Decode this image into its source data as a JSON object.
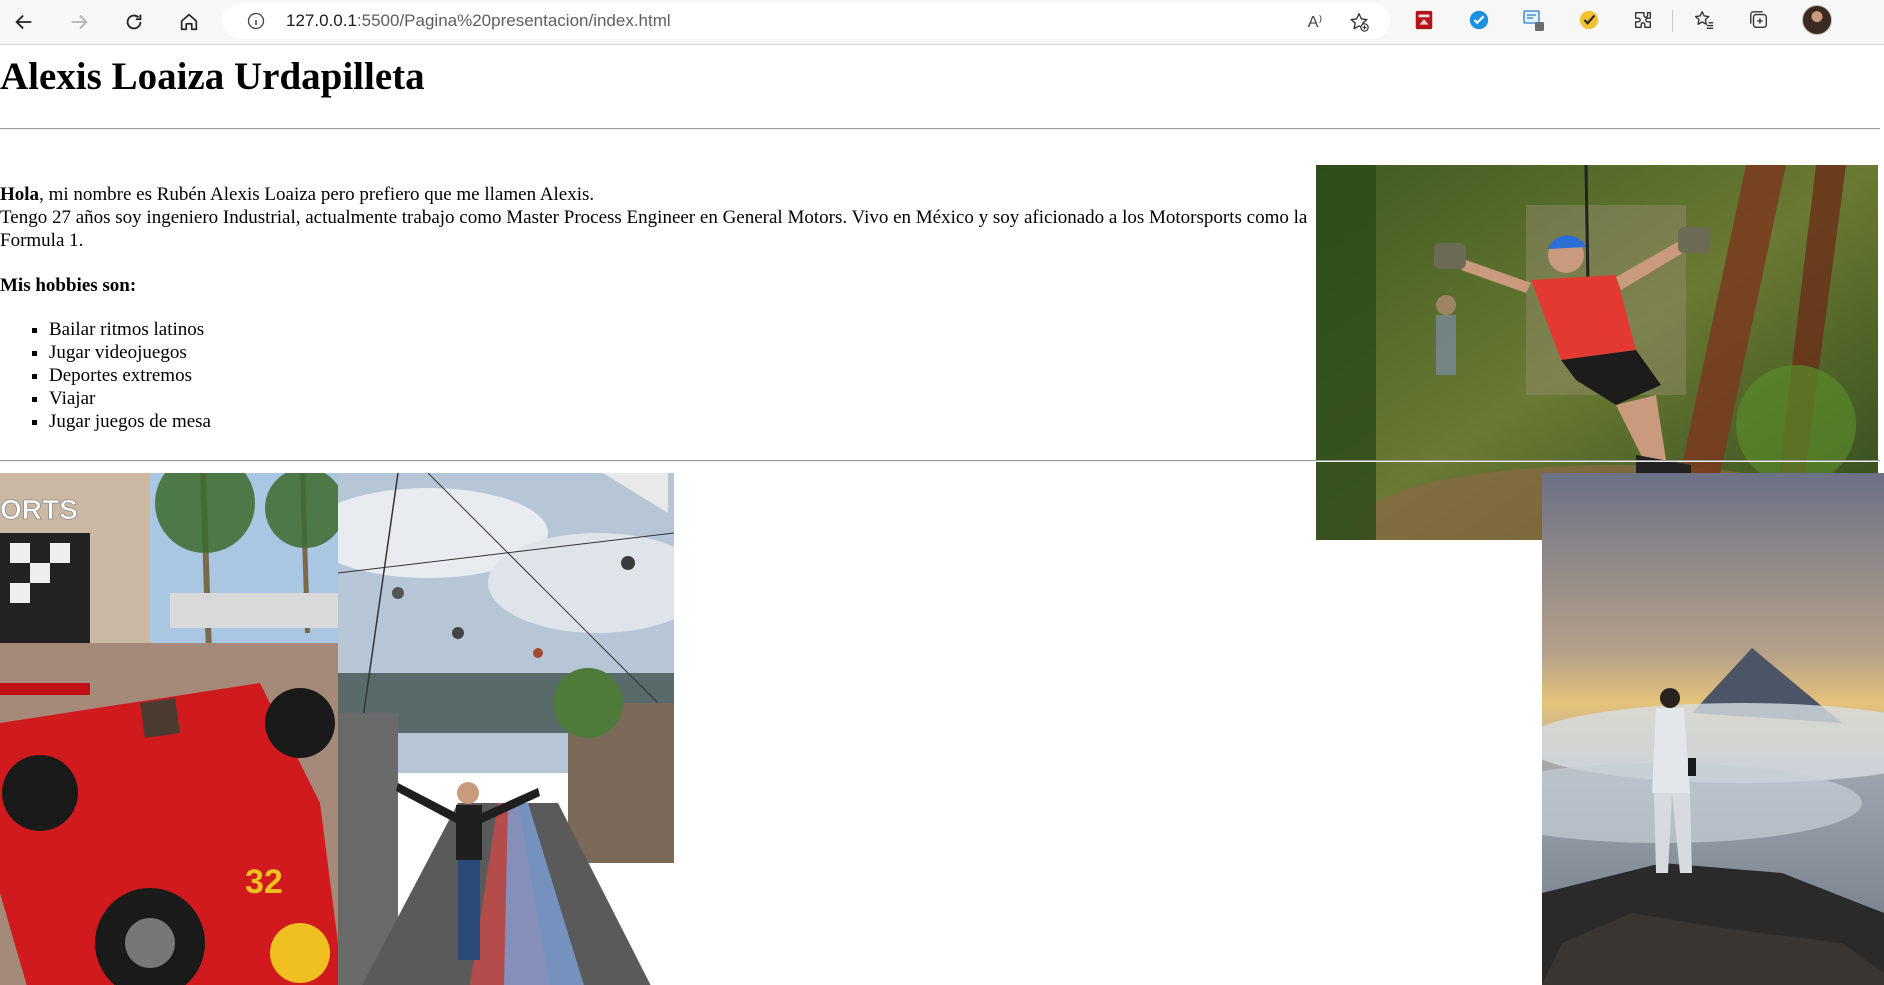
{
  "browser": {
    "url_host": "127.0.0.1",
    "url_rest": ":5500/Pagina%20presentacion/index.html",
    "read_aloud_label": "A⁾"
  },
  "page": {
    "title": "Alexis Loaiza Urdapilleta",
    "intro_bold": "Hola",
    "intro_line1": ", mi nombre es Rubén Alexis Loaiza pero prefiero que me llamen Alexis.",
    "intro_line2": "Tengo 27 años soy ingeniero Industrial, actualmente trabajo como Master Process Engineer en General Motors. Vivo en México y soy aficionado a los Motorsports como la Formula 1.",
    "hobbies_title": "Mis hobbies son:",
    "hobbies": [
      "Bailar ritmos latinos",
      "Jugar videojuegos",
      "Deportes extremos",
      "Viajar",
      "Jugar juegos de mesa"
    ]
  },
  "icons": {
    "back": "arrow-left-icon",
    "forward": "arrow-right-icon",
    "reload": "reload-icon",
    "home": "home-icon",
    "info": "info-icon",
    "favorite": "star-add-icon",
    "favorites": "favorites-icon",
    "collections": "collections-icon",
    "extensions": "puzzle-icon"
  },
  "colors": {
    "toolbar_bg": "#f7f7f7",
    "address_bg": "#ffffff",
    "page_bg": "#ffffff"
  }
}
